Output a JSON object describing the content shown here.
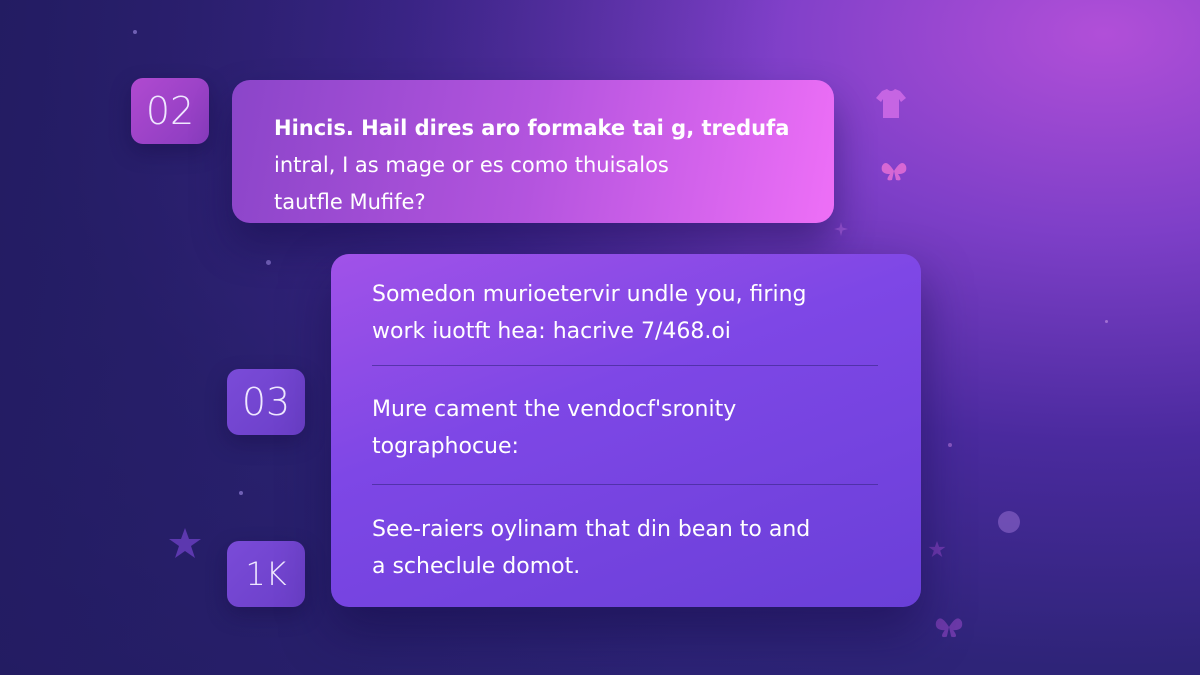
{
  "steps": [
    {
      "badge": "02",
      "lines": [
        "Hincis. Hail dires aro formake tai g, tredufa",
        "intral, I as mage or es como thuisalos",
        "tautfle Mufife?"
      ]
    },
    {
      "lines": [
        "Somedon murioetervir undle you, firing",
        "work iuotft hea: hacrive 7/468.oi"
      ]
    },
    {
      "badge": "03",
      "lines": [
        "Mure cament the vendocf'sronity",
        "tographocue:"
      ]
    },
    {
      "badge": "1K",
      "lines": [
        "See-raiers oylinam that din bean to and",
        "a scheclule domot."
      ]
    }
  ],
  "colors": {
    "background_dark": "#271f6a",
    "background_glow": "#b14fd8",
    "card_top_start": "#8b45c9",
    "card_top_end": "#ee6ff7",
    "card_main_start": "#a152e8",
    "card_main_end": "#6a3fd8",
    "badge_02": "#b04ad0",
    "badge_03": "#7a4bd8",
    "text": "#ffffff"
  },
  "decorations": [
    "star-icon",
    "butterfly-icon",
    "shirt-icon",
    "dot-icon",
    "sparkle-icon"
  ]
}
